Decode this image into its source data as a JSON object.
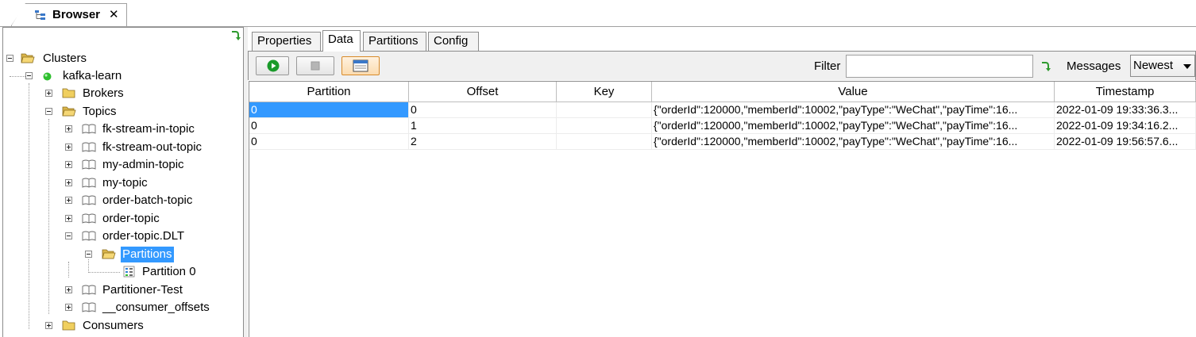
{
  "window": {
    "tab_title": "Browser",
    "tab_close": "✕"
  },
  "tree": {
    "nodes": [
      {
        "label": "Clusters"
      },
      {
        "label": "kafka-learn"
      },
      {
        "label": "Brokers"
      },
      {
        "label": "Topics"
      },
      {
        "label": "fk-stream-in-topic"
      },
      {
        "label": "fk-stream-out-topic"
      },
      {
        "label": "my-admin-topic"
      },
      {
        "label": "my-topic"
      },
      {
        "label": "order-batch-topic"
      },
      {
        "label": "order-topic"
      },
      {
        "label": "order-topic.DLT"
      },
      {
        "label": "Partitions",
        "selected": true
      },
      {
        "label": "Partition 0"
      },
      {
        "label": "Partitioner-Test"
      },
      {
        "label": "__consumer_offsets"
      },
      {
        "label": "Consumers"
      }
    ]
  },
  "tabs": [
    {
      "label": "Properties"
    },
    {
      "label": "Data",
      "active": true
    },
    {
      "label": "Partitions"
    },
    {
      "label": "Config"
    }
  ],
  "toolbar": {
    "start_icon": "play-icon",
    "stop_icon": "stop-icon",
    "view_icon": "window-view-icon",
    "filter_label": "Filter",
    "filter_value": "",
    "messages_label": "Messages",
    "messages_selected": "Newest"
  },
  "table": {
    "columns": [
      "Partition",
      "Offset",
      "Key",
      "Value",
      "Timestamp"
    ],
    "rows": [
      [
        "0",
        "0",
        "",
        "{\"orderId\":120000,\"memberId\":10002,\"payType\":\"WeChat\",\"payTime\":16...",
        "2022-01-09 19:33:36.3..."
      ],
      [
        "0",
        "1",
        "",
        "{\"orderId\":120000,\"memberId\":10002,\"payType\":\"WeChat\",\"payTime\":16...",
        "2022-01-09 19:34:16.2..."
      ],
      [
        "0",
        "2",
        "",
        "{\"orderId\":120000,\"memberId\":10002,\"payType\":\"WeChat\",\"payTime\":16...",
        "2022-01-09 19:56:57.6..."
      ]
    ]
  },
  "colors": {
    "selection": "#3399ff",
    "toolbar_bg": "#f0f0f0",
    "play_green": "#1a9a2a"
  }
}
